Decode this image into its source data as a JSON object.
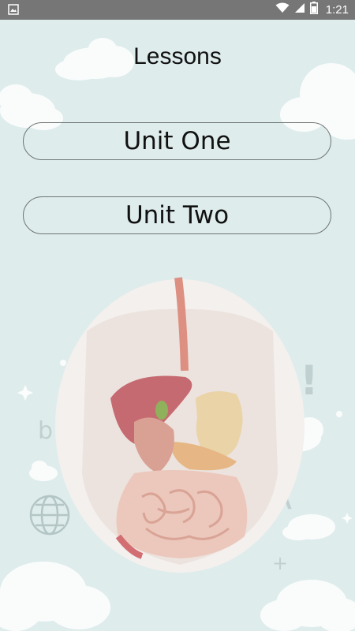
{
  "status_bar": {
    "time": "1:21",
    "left_icon": "image-icon",
    "right_icons": [
      "wifi-icon",
      "signal-icon",
      "battery-icon"
    ]
  },
  "page": {
    "title": "Lessons"
  },
  "buttons": [
    {
      "label": "Unit One"
    },
    {
      "label": "Unit Two"
    }
  ],
  "background_letters": {
    "b": "b",
    "a": "A",
    "exclaim": "!",
    "plus": "+"
  },
  "colors": {
    "status_bar": "#767676",
    "background": "#dfecec",
    "text": "#111111",
    "button_border": "#6e7474"
  }
}
